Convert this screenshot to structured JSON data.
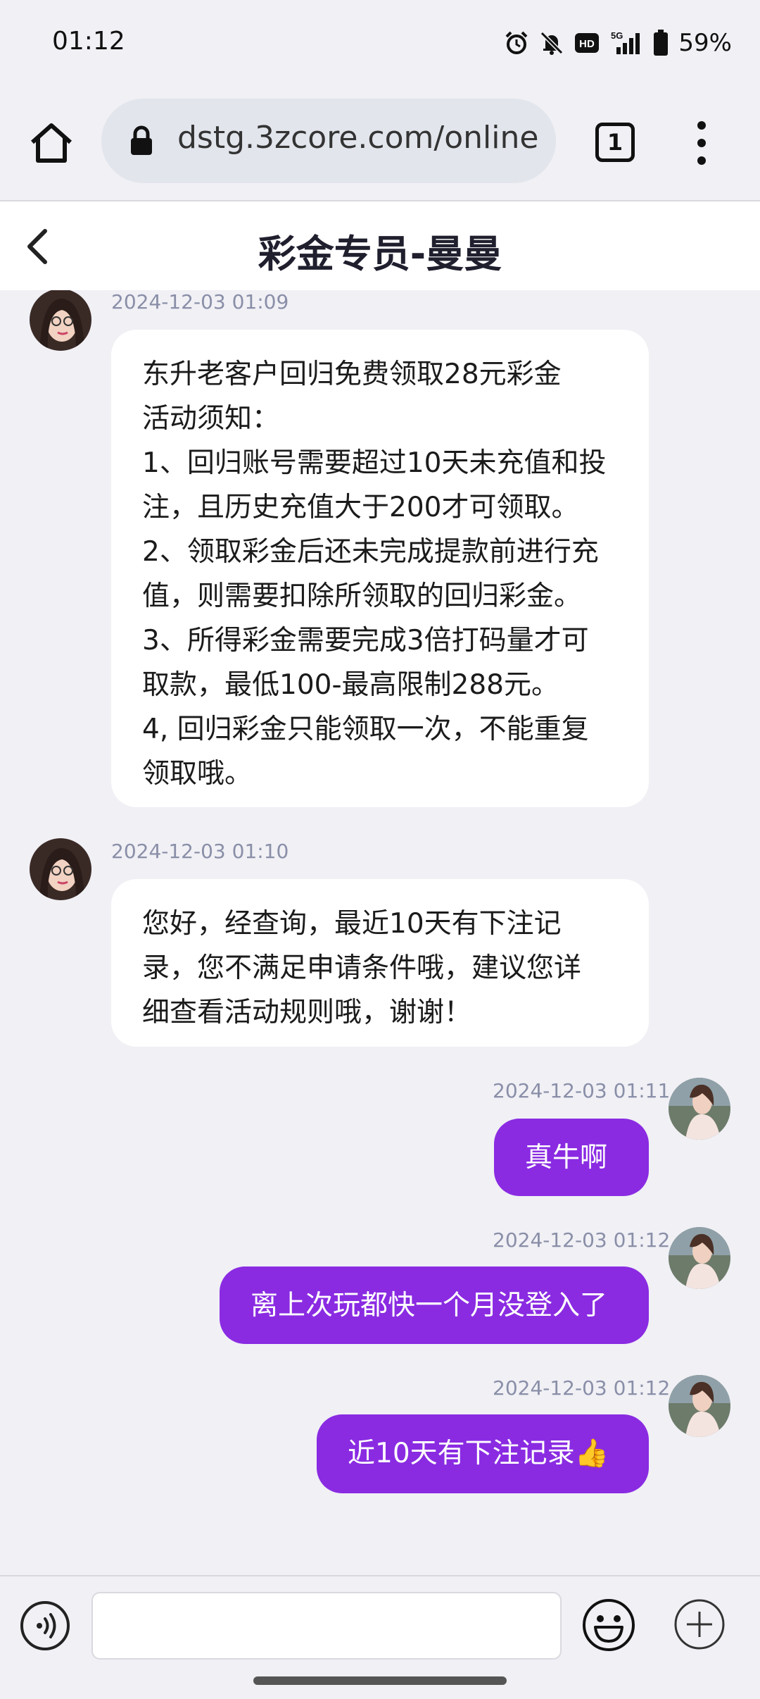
{
  "status_bar": {
    "time": "01:12",
    "battery": "59%",
    "icons": [
      "alarm-icon",
      "bell-off-icon",
      "hd-icon",
      "signal-5g-icon",
      "battery-icon"
    ]
  },
  "browser": {
    "url": "dstg.3zcore.com/online",
    "tab_count": "1"
  },
  "chat": {
    "title": "彩金专员-曼曼",
    "messages": [
      {
        "from": "agent",
        "time": "2024-12-03 01:09",
        "lines": [
          "东升老客户回归免费领取28元彩金",
          "活动须知：",
          "1、回归账号需要超过10天未充值和投",
          "注，且历史充值大于200才可领取。",
          "2、领取彩金后还未完成提款前进行充",
          "值，则需要扣除所领取的回归彩金。",
          "3、所得彩金需要完成3倍打码量才可",
          "取款，最低100-最高限制288元。",
          "4, 回归彩金只能领取一次，不能重复",
          "领取哦。"
        ]
      },
      {
        "from": "agent",
        "time": "2024-12-03 01:10",
        "lines": [
          "您好，经查询，最近10天有下注记",
          "录，您不满足申请条件哦，建议您详",
          "细查看活动规则哦，谢谢！"
        ]
      },
      {
        "from": "user",
        "time": "2024-12-03 01:11",
        "lines": [
          "真牛啊"
        ]
      },
      {
        "from": "user",
        "time": "2024-12-03 01:12",
        "lines": [
          "离上次玩都快一个月没登入了"
        ]
      },
      {
        "from": "user",
        "time": "2024-12-03 01:12",
        "lines": [
          "近10天有下注记录👍"
        ]
      }
    ]
  },
  "input": {
    "placeholder": "",
    "value": ""
  },
  "colors": {
    "accent": "#8a2be2",
    "background": "#f0f0f5",
    "timestamp": "#8a8fa8"
  }
}
